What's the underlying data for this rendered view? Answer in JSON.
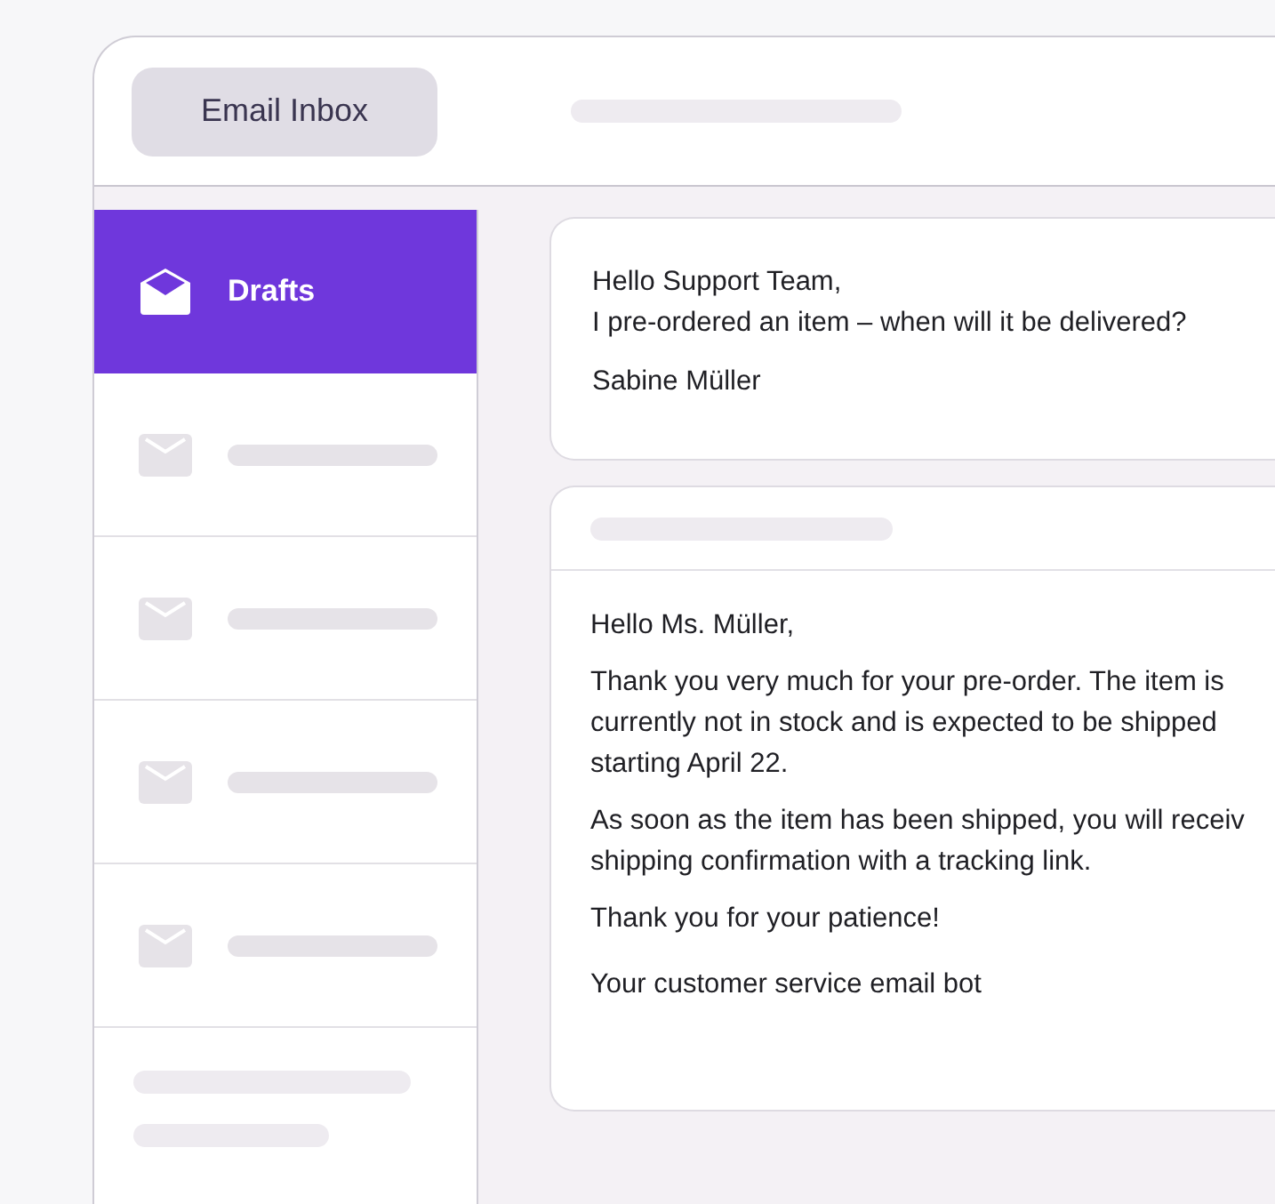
{
  "window": {
    "title": "Email Inbox"
  },
  "sidebar": {
    "items": [
      {
        "label": "Drafts",
        "selected": true
      },
      {
        "selected": false
      },
      {
        "selected": false
      },
      {
        "selected": false
      },
      {
        "selected": false
      }
    ]
  },
  "messages": [
    {
      "kind": "incoming",
      "paragraphs": [
        [
          "Hello Support Team,",
          "I pre-ordered an item – when will it be delivered?"
        ],
        [
          "Sabine Müller"
        ]
      ]
    },
    {
      "kind": "reply",
      "paragraphs": [
        [
          "Hello Ms. Müller,"
        ],
        [
          "Thank you very much for your pre-order. The item is",
          "currently not in stock and is expected to be shipped",
          "starting April 22."
        ],
        [
          "As soon as the item has been shipped, you will receiv",
          "shipping confirmation with a tracking link."
        ],
        [
          "Thank you for your patience!"
        ],
        [
          "Your customer service email bot"
        ]
      ]
    }
  ]
}
